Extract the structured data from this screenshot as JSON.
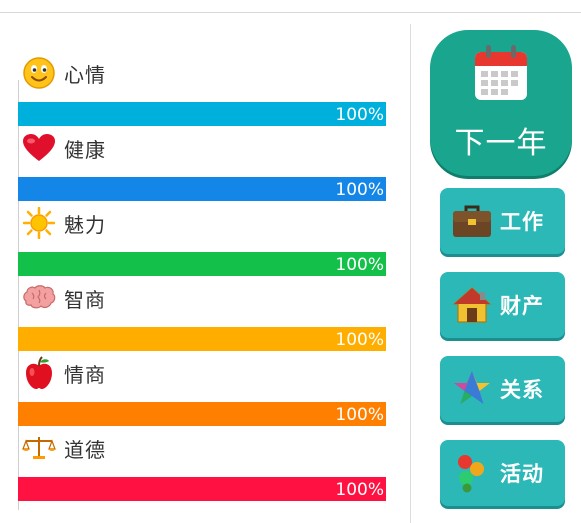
{
  "stats": [
    {
      "label": "心情",
      "percent": "100%",
      "value": 100,
      "icon": "smiley-icon",
      "color": "#00b0dc"
    },
    {
      "label": "健康",
      "percent": "100%",
      "value": 100,
      "icon": "heart-icon",
      "color": "#1486e8"
    },
    {
      "label": "魅力",
      "percent": "100%",
      "value": 100,
      "icon": "sun-icon",
      "color": "#12c04a"
    },
    {
      "label": "智商",
      "percent": "100%",
      "value": 100,
      "icon": "brain-icon",
      "color": "#ffae00"
    },
    {
      "label": "情商",
      "percent": "100%",
      "value": 100,
      "icon": "apple-icon",
      "color": "#ff8000"
    },
    {
      "label": "道德",
      "percent": "100%",
      "value": 100,
      "icon": "scales-icon",
      "color": "#ff1242"
    }
  ],
  "actions": {
    "next_year": {
      "label": "下一年",
      "icon": "calendar-icon"
    },
    "buttons": [
      {
        "label": "工作",
        "icon": "briefcase-icon"
      },
      {
        "label": "财产",
        "icon": "house-icon"
      },
      {
        "label": "关系",
        "icon": "star-icon"
      },
      {
        "label": "活动",
        "icon": "balloons-icon"
      }
    ]
  },
  "colors": {
    "next_year_bg": "#1aa58f",
    "button_bg": "#2db8b8"
  }
}
